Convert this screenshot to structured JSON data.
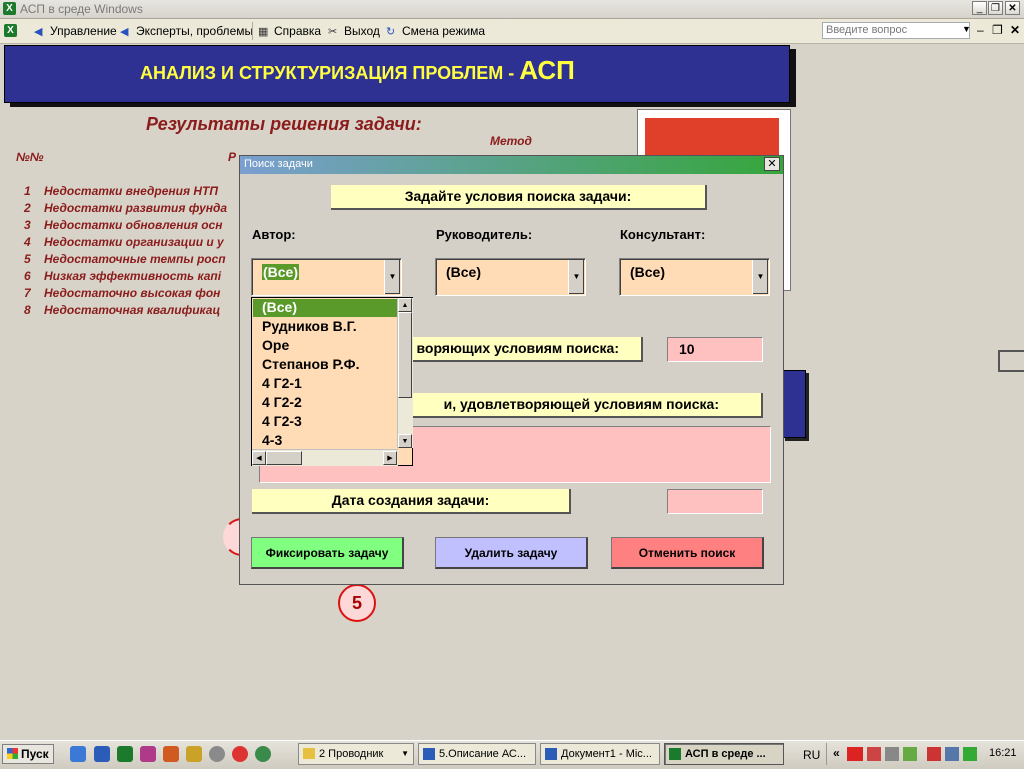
{
  "window": {
    "title": "АСП в среде Windows",
    "app_icon": "excel-icon"
  },
  "menu": {
    "items": [
      "Управление",
      "Эксперты, проблемы",
      "Справка",
      "Выход",
      "Смена режима"
    ],
    "ask_placeholder": "Введите вопрос"
  },
  "header": {
    "title": "АНАЛИЗ И СТРУКТУРИЗАЦИЯ ПРОБЛЕМ  -",
    "acronym": "АСП"
  },
  "sheet": {
    "results_title": "Результаты решения задачи:",
    "col_num": "№№",
    "col_r": "Р",
    "col_method": "Метод",
    "rows": [
      {
        "n": "1",
        "text": "Недостатки внедрения НТП"
      },
      {
        "n": "2",
        "text": "Недостатки развития фунда"
      },
      {
        "n": "3",
        "text": "Недостатки обновления осн"
      },
      {
        "n": "4",
        "text": "Недостатки организации и у"
      },
      {
        "n": "5",
        "text": "Недостаточные темпы росп"
      },
      {
        "n": "6",
        "text": "Низкая эффективность капі"
      },
      {
        "n": "7",
        "text": "Недостаточно высокая фон"
      },
      {
        "n": "8",
        "text": "Недостаточная квалификац"
      }
    ],
    "circle_label": "5"
  },
  "dialog": {
    "title": "Поиск задачи",
    "heading": "Задайте условия поиска задачи:",
    "author_label": "Автор:",
    "manager_label": "Руководитель:",
    "consultant_label": "Консультант:",
    "author_value": "(Все)",
    "manager_value": "(Все)",
    "consultant_value": "(Все)",
    "count_label": "воряющих условиям поиска:",
    "count_value": "10",
    "desc_label": "и, удовлетворяющей условиям поиска:",
    "date_label": "Дата создания задачи:",
    "btn_fix": "Фиксировать задачу",
    "btn_delete": "Удалить задачу",
    "btn_cancel": "Отменить поиск",
    "colors": {
      "fix": "#80ff80",
      "delete": "#c0c0ff",
      "cancel": "#ff8080"
    }
  },
  "dropdown": {
    "options": [
      "(Все)",
      "Рудников В.Г.",
      "Оре",
      "Степанов Р.Ф.",
      "4 Г2-1",
      "4 Г2-2",
      "4 Г2-3",
      "4-3"
    ]
  },
  "taskbar": {
    "start": "Пуск",
    "tasks": [
      "2 Проводник",
      "5.Описание АС...",
      "Документ1 - Mic...",
      "АСП в среде ..."
    ],
    "lang": "RU",
    "clock": "16:21"
  }
}
